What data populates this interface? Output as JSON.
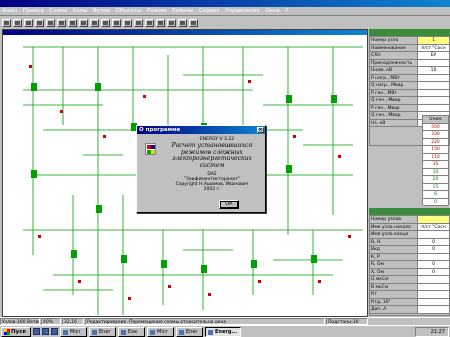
{
  "menu": {
    "items": [
      "Файл",
      "Правка",
      "Схема",
      "Узлы",
      "Ветви",
      "Объекты",
      "Режим",
      "Районы",
      "Сервис",
      "Управление",
      "Окна",
      "?"
    ]
  },
  "toolbar": {
    "buttons": [
      "new-icon",
      "open-icon",
      "save-icon",
      "print-icon",
      "cut-icon",
      "copy-icon",
      "paste-icon",
      "zoom-in-icon",
      "zoom-out-icon",
      "grid-icon",
      "node-icon",
      "branch-icon",
      "calc-icon",
      "table-icon",
      "chart-icon",
      "settings-icon",
      "window-icon",
      "help-icon"
    ]
  },
  "node_panel": {
    "rows": [
      {
        "label": "Номер узла",
        "value": "1"
      },
      {
        "label": "Наименование",
        "value": "п/ст \"Сосн"
      },
      {
        "label": "СХН",
        "value": "БУ"
      },
      {
        "label": "Принадлежность",
        "value": ""
      },
      {
        "label": "Uном, кВ",
        "value": "10"
      },
      {
        "label": "P нагр., МВт",
        "value": ""
      },
      {
        "label": "Q нагр., Мвар",
        "value": ""
      },
      {
        "label": "P ген., МВт",
        "value": ""
      },
      {
        "label": "Q ген., Мвар",
        "value": ""
      },
      {
        "label": "P ген., Мвар",
        "value": ""
      },
      {
        "label": "Q ген., Мвар",
        "value": ""
      },
      {
        "label": "Uз, кВ",
        "value": ""
      }
    ]
  },
  "values_column": {
    "header": "Uном",
    "values": [
      "500",
      "330",
      "220",
      "150",
      "110",
      "35",
      "10",
      "20",
      "15",
      "6",
      "0"
    ]
  },
  "branch_panel": {
    "rows": [
      {
        "label": "Номер узлов",
        "value": ""
      },
      {
        "label": "Имя узла начала",
        "value": "п/ст \"Сосн"
      },
      {
        "label": "Имя узла конца",
        "value": ""
      },
      {
        "label": "В, Н",
        "value": "0"
      },
      {
        "label": "Вкд",
        "value": "0"
      },
      {
        "label": "К, Р",
        "value": ""
      },
      {
        "label": "R, Ом",
        "value": "0"
      },
      {
        "label": "Х, Ом",
        "value": "0"
      },
      {
        "label": "G мкСм",
        "value": ""
      },
      {
        "label": "В мкСм",
        "value": ""
      },
      {
        "label": "Кт",
        "value": ""
      },
      {
        "label": "Ктд, 10³",
        "value": ""
      },
      {
        "label": "Доп. А",
        "value": ""
      }
    ]
  },
  "dialog": {
    "title": "О программе",
    "close": "×",
    "version": "ENERGY V 3.22",
    "description": "Расчет установившихся режимов сложных электроэнергетических систем",
    "org_line1": "DA2",
    "org_line2": "\"Заифиментисторанит\"",
    "copyright": "Copyright Н.Ашимов, Иванович",
    "year": "2002 г.",
    "ok_label": "ОК"
  },
  "status": {
    "nodes": "Узлов-160 Ветвей-156",
    "zoom": "40%",
    "coords": "32,16",
    "hint": "Редактирование. Перемещение схемы относительно окна",
    "substations": "Подстанц-10"
  },
  "taskbar": {
    "start": "Пуск",
    "tasks": [
      "Micr",
      "Ener",
      "Exe",
      "Micr",
      "Ener",
      "Energ..."
    ],
    "clock": "21:27"
  },
  "colors": {
    "grid_green": "#00a000",
    "node_red": "#d00000",
    "panel_green": "#3a8b3a",
    "title_blue": "#000080"
  }
}
